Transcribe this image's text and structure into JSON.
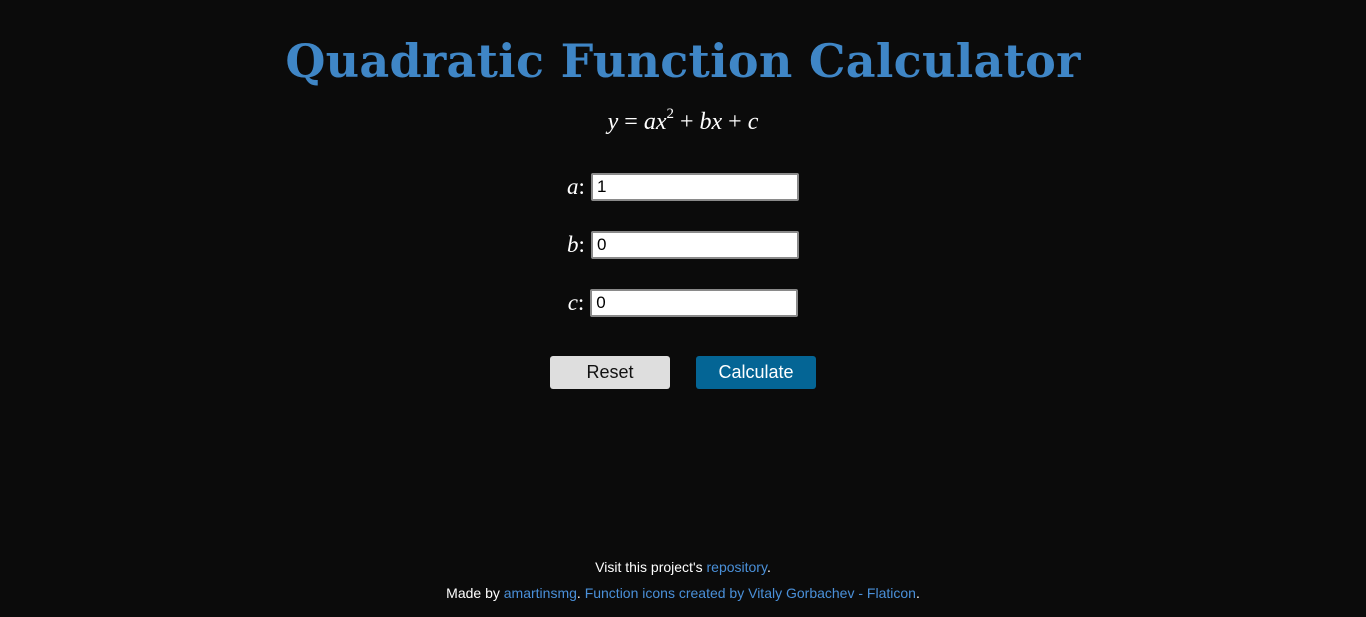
{
  "header": {
    "title": "Quadratic Function Calculator"
  },
  "formula": {
    "y": "y",
    "equals": " = ",
    "a": "a",
    "x1": "x",
    "exp": "2",
    "plus1": " + ",
    "bx": "bx",
    "plus2": " + ",
    "c": "c"
  },
  "form": {
    "a": {
      "var": "a",
      "colon": ":",
      "value": "1"
    },
    "b": {
      "var": "b",
      "colon": ":",
      "value": "0"
    },
    "c": {
      "var": "c",
      "colon": ":",
      "value": "0"
    }
  },
  "buttons": {
    "reset_label": "Reset",
    "calculate_label": "Calculate"
  },
  "footer": {
    "line1_prefix": "Visit this project's ",
    "line1_link": "repository",
    "line1_suffix": ".",
    "line2_prefix": "Made by ",
    "line2_author": "amartinsmg",
    "line2_sep": ". ",
    "line2_credit": "Function icons created by Vitaly Gorbachev - Flaticon",
    "line2_suffix": "."
  },
  "colors": {
    "background": "#0b0b0b",
    "title": "#3f86c6",
    "link": "#4a90d9",
    "calculate_button": "#046595",
    "reset_button": "#dedede"
  }
}
